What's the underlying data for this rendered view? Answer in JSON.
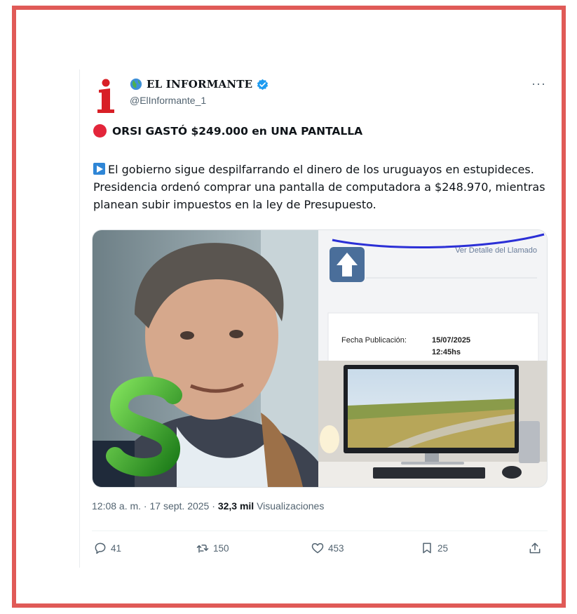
{
  "account": {
    "name": "EL INFORMANTE",
    "handle": "@ElInformante_1",
    "verified_color": "#1d9bf0",
    "logo_letter": "i"
  },
  "post": {
    "headline": "ORSI GASTÓ $249.000 en UNA PANTALLA",
    "body": "El gobierno sigue despilfarrando el dinero de los uruguayos en estupideces. Presidencia ordenó comprar una pantalla de computadora a $248.970, mientras planean subir impuestos en la ley de Presupuesto.",
    "time": "12:08 a. m.",
    "date": "17 sept. 2025",
    "views_count": "32,3 mil",
    "views_label": "Visualizaciones"
  },
  "media": {
    "doc_link": "Ver Detalle del Llamado",
    "pub_label": "Fecha Publicación:",
    "pub_date": "15/07/2025",
    "pub_time": "12:45hs"
  },
  "actions": {
    "replies": "41",
    "reposts": "150",
    "likes": "453",
    "bookmarks": "25"
  },
  "colors": {
    "frame_border": "#e05a57",
    "headline_dot": "#e3253a",
    "annotation": "#2b2fd6",
    "text_primary": "#0f1419",
    "text_secondary": "#536471"
  }
}
